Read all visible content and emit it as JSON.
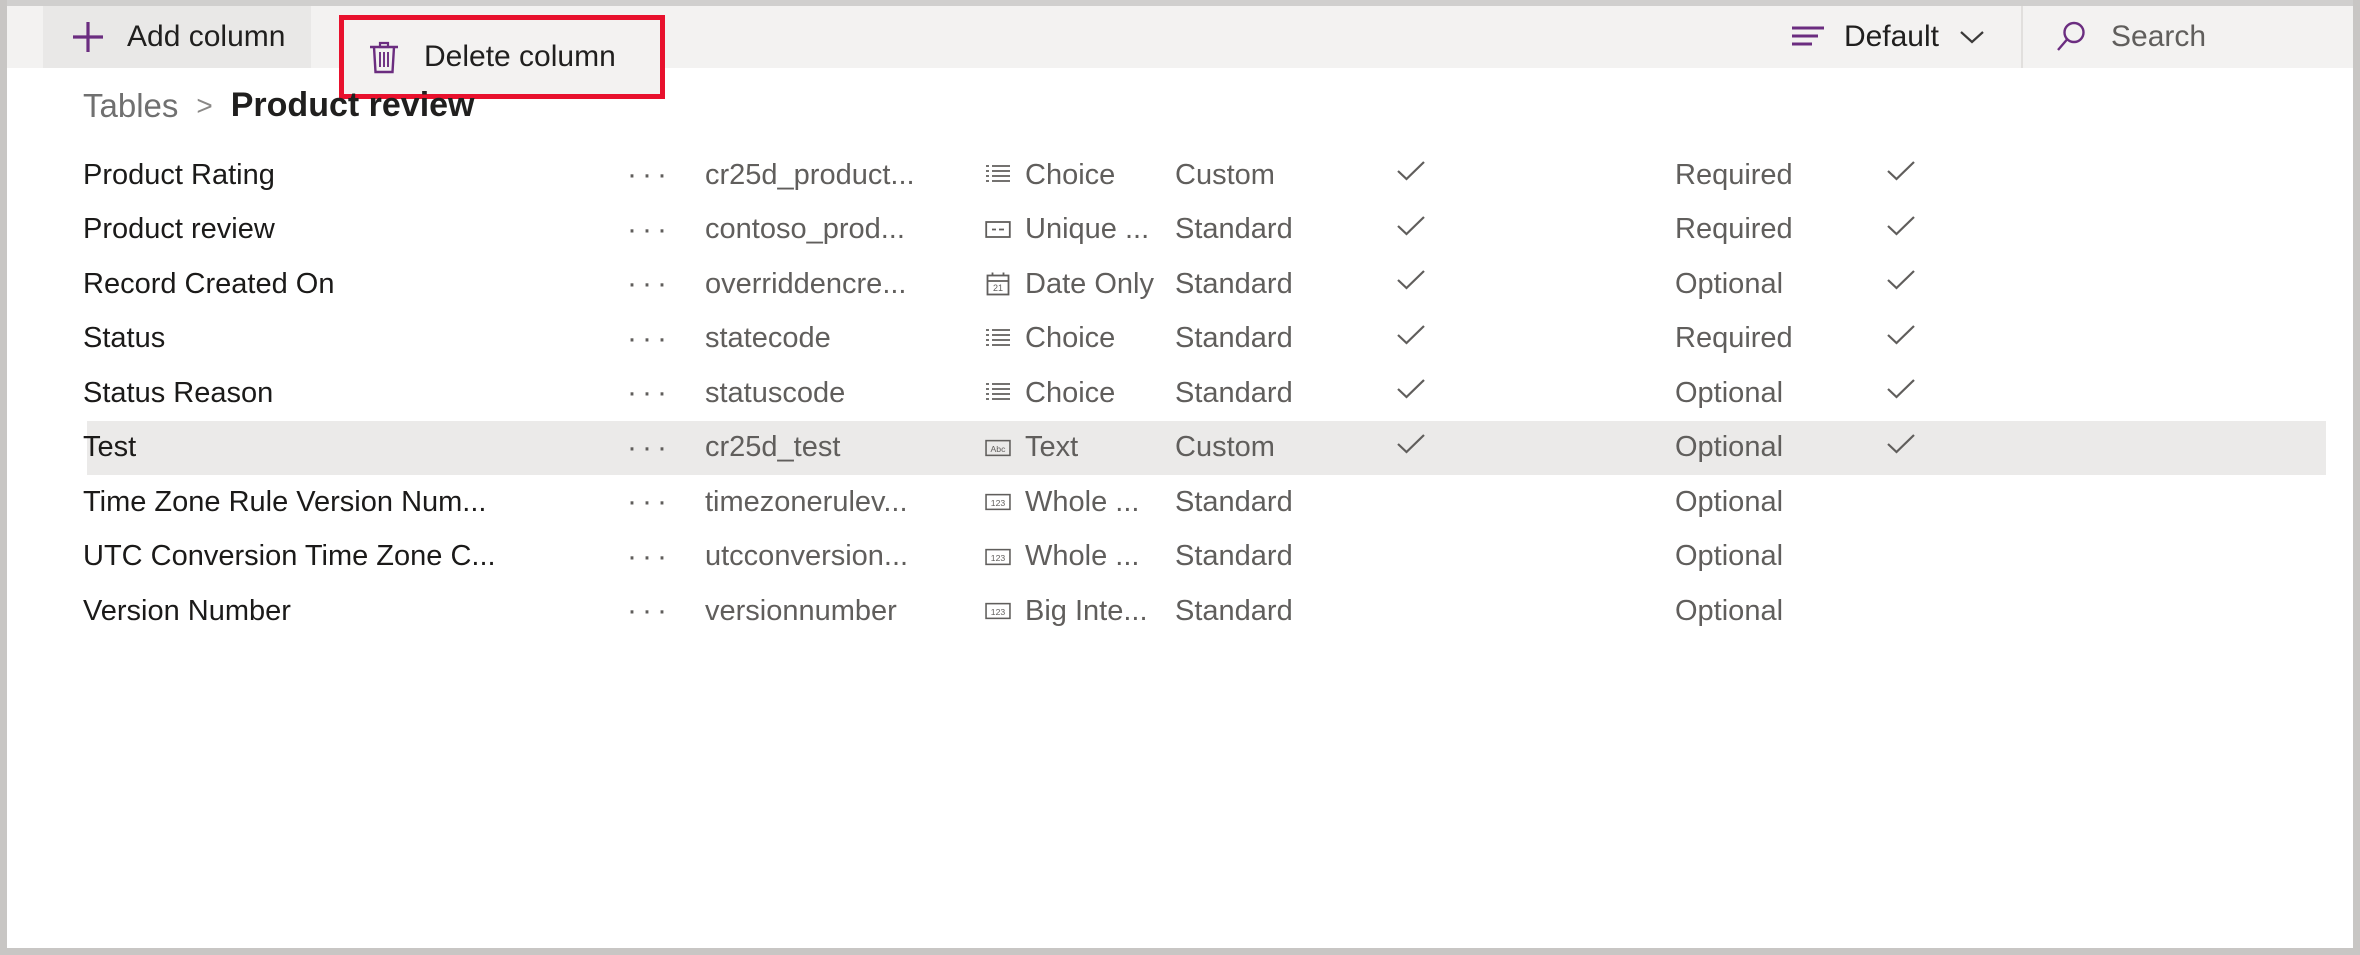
{
  "command_bar": {
    "add_column": {
      "label": "Add column",
      "icon": "plus-icon"
    },
    "delete_column": {
      "label": "Delete column",
      "icon": "trash-icon"
    },
    "view_selector": {
      "label": "Default",
      "icon": "view-list-icon",
      "chevron": "chevron-down-icon"
    },
    "search": {
      "placeholder": "Search",
      "icon": "search-icon"
    }
  },
  "breadcrumb": {
    "parent": "Tables",
    "separator": ">",
    "current": "Product review"
  },
  "grid": {
    "rows": [
      {
        "display_name": "Product Rating",
        "menu": "···",
        "logical_name": "cr25d_product...",
        "data_type": "Choice",
        "type_icon": "choice-icon",
        "custom_standard": "Custom",
        "searchable_check": "✓",
        "requirement": "Required",
        "trailing_check": "✓",
        "selected": false
      },
      {
        "display_name": "Product review",
        "menu": "···",
        "logical_name": "contoso_prod...",
        "data_type": "Unique ...",
        "type_icon": "unique-id-icon",
        "custom_standard": "Standard",
        "searchable_check": "✓",
        "requirement": "Required",
        "trailing_check": "✓",
        "selected": false
      },
      {
        "display_name": "Record Created On",
        "menu": "···",
        "logical_name": "overriddencre...",
        "data_type": "Date Only",
        "type_icon": "calendar-icon",
        "custom_standard": "Standard",
        "searchable_check": "✓",
        "requirement": "Optional",
        "trailing_check": "✓",
        "selected": false
      },
      {
        "display_name": "Status",
        "menu": "···",
        "logical_name": "statecode",
        "data_type": "Choice",
        "type_icon": "choice-icon",
        "custom_standard": "Standard",
        "searchable_check": "✓",
        "requirement": "Required",
        "trailing_check": "✓",
        "selected": false
      },
      {
        "display_name": "Status Reason",
        "menu": "···",
        "logical_name": "statuscode",
        "data_type": "Choice",
        "type_icon": "choice-icon",
        "custom_standard": "Standard",
        "searchable_check": "✓",
        "requirement": "Optional",
        "trailing_check": "✓",
        "selected": false
      },
      {
        "display_name": "Test",
        "menu": "···",
        "logical_name": "cr25d_test",
        "data_type": "Text",
        "type_icon": "text-abc-icon",
        "custom_standard": "Custom",
        "searchable_check": "✓",
        "requirement": "Optional",
        "trailing_check": "✓",
        "selected": true
      },
      {
        "display_name": "Time Zone Rule Version Num...",
        "menu": "···",
        "logical_name": "timezonerulev...",
        "data_type": "Whole ...",
        "type_icon": "number-123-icon",
        "custom_standard": "Standard",
        "searchable_check": "",
        "requirement": "Optional",
        "trailing_check": "",
        "selected": false
      },
      {
        "display_name": "UTC Conversion Time Zone C...",
        "menu": "···",
        "logical_name": "utcconversion...",
        "data_type": "Whole ...",
        "type_icon": "number-123-icon",
        "custom_standard": "Standard",
        "searchable_check": "",
        "requirement": "Optional",
        "trailing_check": "",
        "selected": false
      },
      {
        "display_name": "Version Number",
        "menu": "···",
        "logical_name": "versionnumber",
        "data_type": "Big Inte...",
        "type_icon": "number-123-icon",
        "custom_standard": "Standard",
        "searchable_check": "",
        "requirement": "Optional",
        "trailing_check": "",
        "selected": false
      }
    ]
  },
  "colors": {
    "accent_purple": "#6b2d80",
    "annotation_red": "#e8112d",
    "command_bar_bg": "#f3f2f1",
    "selected_row_bg": "#ebeae9",
    "frame_border": "#c8c6c4"
  }
}
